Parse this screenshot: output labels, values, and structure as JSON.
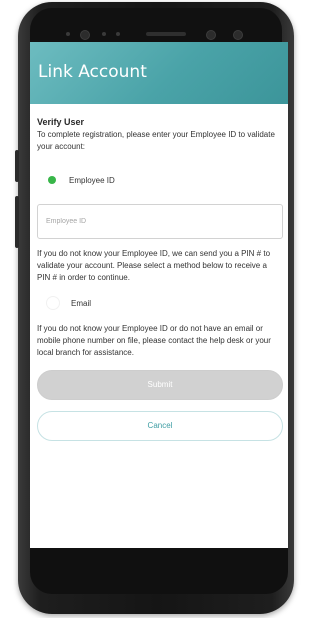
{
  "header": {
    "title": "Link Account"
  },
  "verify": {
    "title": "Verify User",
    "intro": "To complete registration, please enter your Employee ID to validate your account:"
  },
  "options": {
    "employee_id_label": "Employee ID",
    "employee_id_selected": true,
    "email_label": "Email",
    "email_selected": false
  },
  "employee_input": {
    "value": "",
    "placeholder": "Employee ID"
  },
  "help": {
    "pin_text": "If you do not know your Employee ID, we can send you a PIN # to validate your account. Please select a method below to receive a PIN # in order to continue.",
    "contact_text": "If you do not know your Employee ID or do not have an email or mobile phone number on file, please contact the help desk or your local branch for assistance."
  },
  "actions": {
    "submit_label": "Submit",
    "cancel_label": "Cancel"
  },
  "colors": {
    "header_teal": "#4aa3a8",
    "radio_selected_green": "#38b649",
    "submit_disabled_gray": "#d1d1d1",
    "cancel_text_teal": "#3f9ea4"
  }
}
